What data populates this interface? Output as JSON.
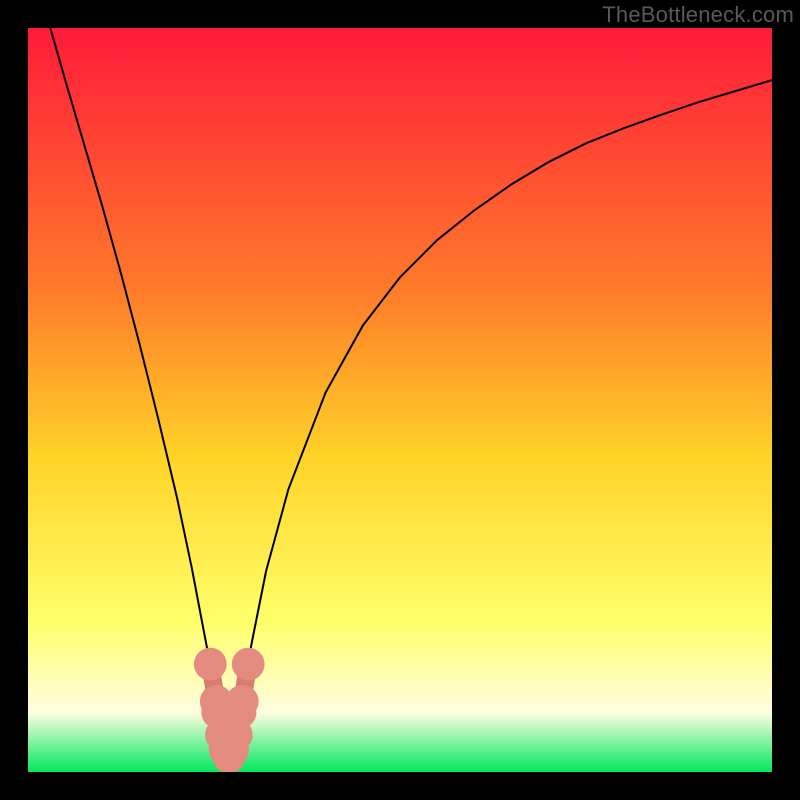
{
  "watermark": "TheBottleneck.com",
  "colors": {
    "frame": "#000000",
    "gradient_top": "#ff1a3a",
    "gradient_mid_upper": "#ff7a2a",
    "gradient_mid": "#ffd427",
    "gradient_mid_lower": "#ffff6b",
    "gradient_low": "#fffde0",
    "gradient_bottom": "#00e85e",
    "curve": "#000000",
    "marker_stroke": "#d97b70",
    "marker_fill": "#e48b80"
  },
  "chart_data": {
    "type": "line",
    "title": "",
    "xlabel": "",
    "ylabel": "",
    "xlim": [
      0,
      100
    ],
    "ylim": [
      0,
      100
    ],
    "minimum_x": 27,
    "series": [
      {
        "name": "bottleneck-curve",
        "x": [
          3,
          5,
          7.5,
          10,
          12.5,
          15,
          17.5,
          20,
          22,
          24,
          25,
          25.5,
          26,
          26.5,
          27,
          27.5,
          28,
          28.5,
          29,
          30,
          32,
          35,
          40,
          45,
          50,
          55,
          60,
          65,
          70,
          75,
          80,
          85,
          90,
          95,
          100
        ],
        "values": [
          100,
          93,
          84.5,
          76,
          67,
          57.5,
          47.5,
          37,
          27.5,
          17,
          11,
          8,
          5,
          3,
          2,
          3,
          5,
          8,
          11,
          17,
          27,
          38,
          51,
          60,
          66.5,
          71.5,
          75.5,
          79,
          82,
          84.5,
          86.5,
          88.3,
          90,
          91.5,
          93
        ]
      }
    ],
    "markers": {
      "name": "valley-highlight",
      "x": [
        24.5,
        25.3,
        25.5,
        26,
        26.5,
        27,
        27.5,
        28,
        28.5,
        28.8,
        29.6
      ],
      "values": [
        14.5,
        9.5,
        8,
        5,
        3,
        2,
        3,
        5,
        8,
        9.5,
        14.5
      ],
      "radius": 2.2
    }
  }
}
